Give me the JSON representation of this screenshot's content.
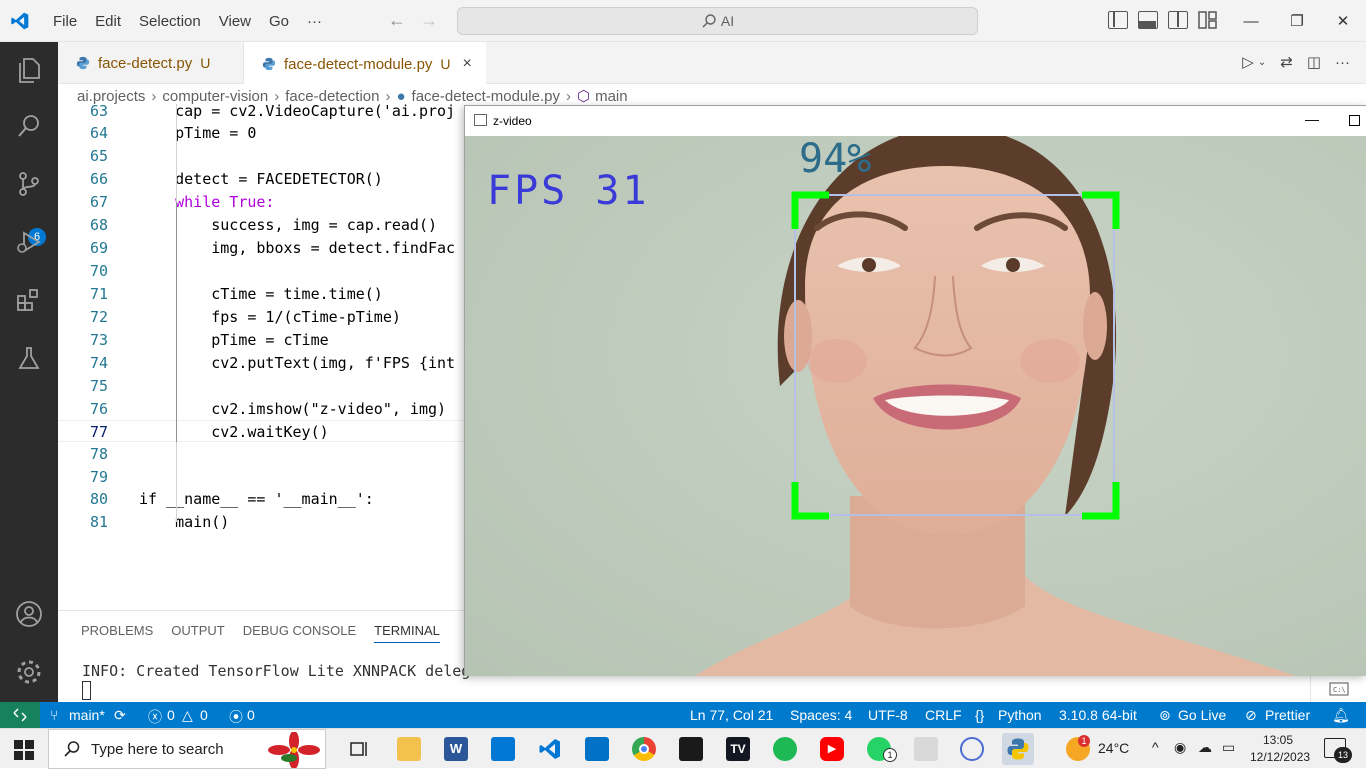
{
  "titlebar": {
    "menus": [
      "File",
      "Edit",
      "Selection",
      "View",
      "Go",
      "···"
    ],
    "command_center": "AI"
  },
  "activity_bar": {
    "scm_badge": "6"
  },
  "tabs": [
    {
      "label": "face-detect.py",
      "status": "U"
    },
    {
      "label": "face-detect-module.py",
      "status": "U",
      "close": "×"
    }
  ],
  "breadcrumb": [
    "ai.projects",
    "computer-vision",
    "face-detection",
    "face-detect-module.py",
    "main"
  ],
  "editor": {
    "lines": [
      {
        "n": "63",
        "code": "    cap = cv2.VideoCapture('ai.proj"
      },
      {
        "n": "64",
        "code": "    pTime = 0"
      },
      {
        "n": "65",
        "code": ""
      },
      {
        "n": "66",
        "code": "    detect = FACEDETECTOR()"
      },
      {
        "n": "67",
        "code": "    while True:"
      },
      {
        "n": "68",
        "code": "        success, img = cap.read()"
      },
      {
        "n": "69",
        "code": "        img, bboxs = detect.findFac"
      },
      {
        "n": "70",
        "code": ""
      },
      {
        "n": "71",
        "code": "        cTime = time.time()"
      },
      {
        "n": "72",
        "code": "        fps = 1/(cTime-pTime)"
      },
      {
        "n": "73",
        "code": "        pTime = cTime"
      },
      {
        "n": "74",
        "code": "        cv2.putText(img, f'FPS {int"
      },
      {
        "n": "75",
        "code": ""
      },
      {
        "n": "76",
        "code": "        cv2.imshow(\"z-video\", img)"
      },
      {
        "n": "77",
        "code": "        cv2.waitKey()"
      },
      {
        "n": "78",
        "code": ""
      },
      {
        "n": "79",
        "code": ""
      },
      {
        "n": "80",
        "code": "if __name__ == '__main__':"
      },
      {
        "n": "81",
        "code": "    main()"
      }
    ]
  },
  "panel": {
    "tabs": [
      "PROBLEMS",
      "OUTPUT",
      "DEBUG CONSOLE",
      "TERMINAL"
    ],
    "active_tab": "TERMINAL",
    "terminal_line": "INFO: Created TensorFlow Lite XNNPACK delegate for CPU."
  },
  "video_window": {
    "title": "z-video",
    "fps_text": "FPS 31",
    "confidence_text": "94%"
  },
  "statusbar": {
    "branch": "main*",
    "errors": "0",
    "warnings": "0",
    "ports": "0",
    "position": "Ln 77, Col 21",
    "spaces": "Spaces: 4",
    "encoding": "UTF-8",
    "eol": "CRLF",
    "language": "Python",
    "interpreter": "3.10.8 64-bit",
    "golive": "Go Live",
    "prettier": "Prettier"
  },
  "taskbar": {
    "search_placeholder": "Type here to search",
    "weather": "24°C",
    "time": "13:05",
    "date": "12/12/2023",
    "notifications": "13",
    "whatsapp_badge": "1",
    "weather_badge": "1"
  },
  "colors": {
    "accent": "#007acc",
    "remote": "#16825d",
    "activity_bar": "#2c2c2c",
    "bbox_corner": "#00ff00",
    "overlay_text": "#3a3ad8"
  }
}
